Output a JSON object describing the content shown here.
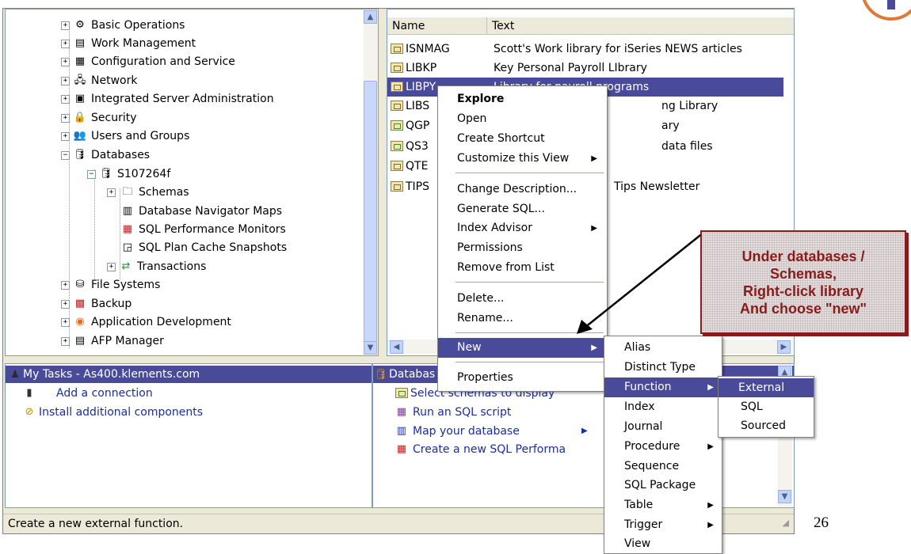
{
  "tree": {
    "items": [
      {
        "label": "Basic Operations",
        "icon": "basic-operations-icon"
      },
      {
        "label": "Work Management",
        "icon": "work-management-icon"
      },
      {
        "label": "Configuration and Service",
        "icon": "configuration-icon"
      },
      {
        "label": "Network",
        "icon": "network-icon"
      },
      {
        "label": "Integrated Server Administration",
        "icon": "server-admin-icon"
      },
      {
        "label": "Security",
        "icon": "security-icon"
      },
      {
        "label": "Users and Groups",
        "icon": "users-icon"
      },
      {
        "label": "Databases",
        "icon": "databases-icon"
      },
      {
        "label": "S107264f",
        "icon": "database-server-icon"
      },
      {
        "label": "Schemas",
        "icon": "schemas-icon"
      },
      {
        "label": "Database Navigator Maps",
        "icon": "navigator-maps-icon"
      },
      {
        "label": "SQL Performance Monitors",
        "icon": "performance-monitor-icon"
      },
      {
        "label": "SQL Plan Cache Snapshots",
        "icon": "plan-cache-icon"
      },
      {
        "label": "Transactions",
        "icon": "transactions-icon"
      },
      {
        "label": "File Systems",
        "icon": "file-systems-icon"
      },
      {
        "label": "Backup",
        "icon": "backup-icon"
      },
      {
        "label": "Application Development",
        "icon": "app-dev-icon"
      },
      {
        "label": "AFP Manager",
        "icon": "afp-icon"
      }
    ]
  },
  "list": {
    "col_name": "Name",
    "col_text": "Text",
    "rows": [
      {
        "name": "ISNMAG",
        "text": "Scott's Work library for iSeries NEWS articles"
      },
      {
        "name": "LIBKP",
        "text": "Key Personal Payroll LIbrary"
      },
      {
        "name": "LIBPY",
        "text": "Library for payroll programs"
      },
      {
        "name": "LIBS",
        "text": "ng Library"
      },
      {
        "name": "QGP",
        "text": "ary"
      },
      {
        "name": "QS3",
        "text": "data files"
      },
      {
        "name": "QTE",
        "text": ""
      },
      {
        "name": "TIPS",
        "text": "Tips Newsletter"
      }
    ]
  },
  "context_menu": {
    "items": [
      "Explore",
      "Open",
      "Create Shortcut",
      "Customize this View",
      "Change Description...",
      "Generate SQL...",
      "Index Advisor",
      "Permissions",
      "Remove from List",
      "Delete...",
      "Rename...",
      "New",
      "Properties"
    ]
  },
  "new_menu": {
    "items": [
      "Alias",
      "Distinct Type",
      "Function",
      "Index",
      "Journal",
      "Procedure",
      "Sequence",
      "SQL Package",
      "Table",
      "Trigger",
      "View"
    ]
  },
  "function_menu": {
    "items": [
      "External",
      "SQL",
      "Sourced"
    ]
  },
  "tasks": {
    "title": "My Tasks - As400.klements.com",
    "items": [
      "Add a connection",
      "Install additional components"
    ]
  },
  "db_tasks": {
    "title": "Databas",
    "items": [
      "Select schemas to display",
      "Run an SQL script",
      "Map your database",
      "Create a new SQL Performa"
    ]
  },
  "status_text": "Create a new external function.",
  "callout": {
    "lines": [
      "Under databases /",
      "Schemas,",
      "Right-click library",
      "And choose \"new\""
    ]
  },
  "page_number": "26",
  "colors": {
    "selection": "#316ac5",
    "callout_border": "#8b1a1a",
    "window_bg": "#ece9d8"
  }
}
